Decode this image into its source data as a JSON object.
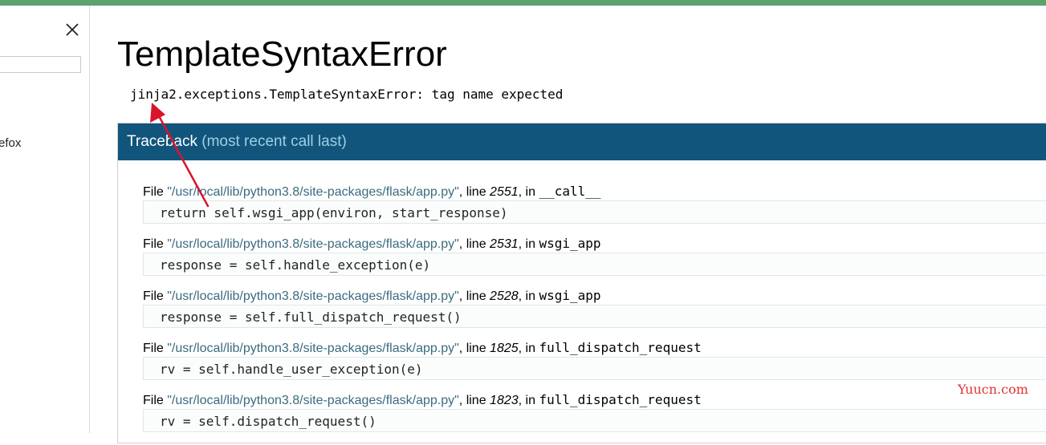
{
  "sidebar": {
    "close_icon": "close-icon",
    "search_value": "",
    "text": "efox"
  },
  "page": {
    "title": "TemplateSyntaxError",
    "error_message": "jinja2.exceptions.TemplateSyntaxError: tag name expected"
  },
  "traceback": {
    "header_main": "Traceback",
    "header_sub": "(most recent call last)",
    "file_prefix": "File ",
    "line_label": ", line ",
    "in_label": ", in ",
    "frames": [
      {
        "path": "\"/usr/local/lib/python3.8/site-packages/flask/app.py\"",
        "line": "2551",
        "func": "__call__",
        "code": "return self.wsgi_app(environ, start_response)"
      },
      {
        "path": "\"/usr/local/lib/python3.8/site-packages/flask/app.py\"",
        "line": "2531",
        "func": "wsgi_app",
        "code": "response = self.handle_exception(e)"
      },
      {
        "path": "\"/usr/local/lib/python3.8/site-packages/flask/app.py\"",
        "line": "2528",
        "func": "wsgi_app",
        "code": "response = self.full_dispatch_request()"
      },
      {
        "path": "\"/usr/local/lib/python3.8/site-packages/flask/app.py\"",
        "line": "1825",
        "func": "full_dispatch_request",
        "code": "rv = self.handle_user_exception(e)"
      },
      {
        "path": "\"/usr/local/lib/python3.8/site-packages/flask/app.py\"",
        "line": "1823",
        "func": "full_dispatch_request",
        "code": "rv = self.dispatch_request()"
      }
    ]
  },
  "watermark": "Yuucn.com",
  "colors": {
    "header_bg": "#11557c",
    "header_sub": "#9ed0e3",
    "path": "#3a6b7e",
    "arrow": "#d9142b",
    "watermark": "#e0312f",
    "top_strip": "#5aa36c"
  }
}
